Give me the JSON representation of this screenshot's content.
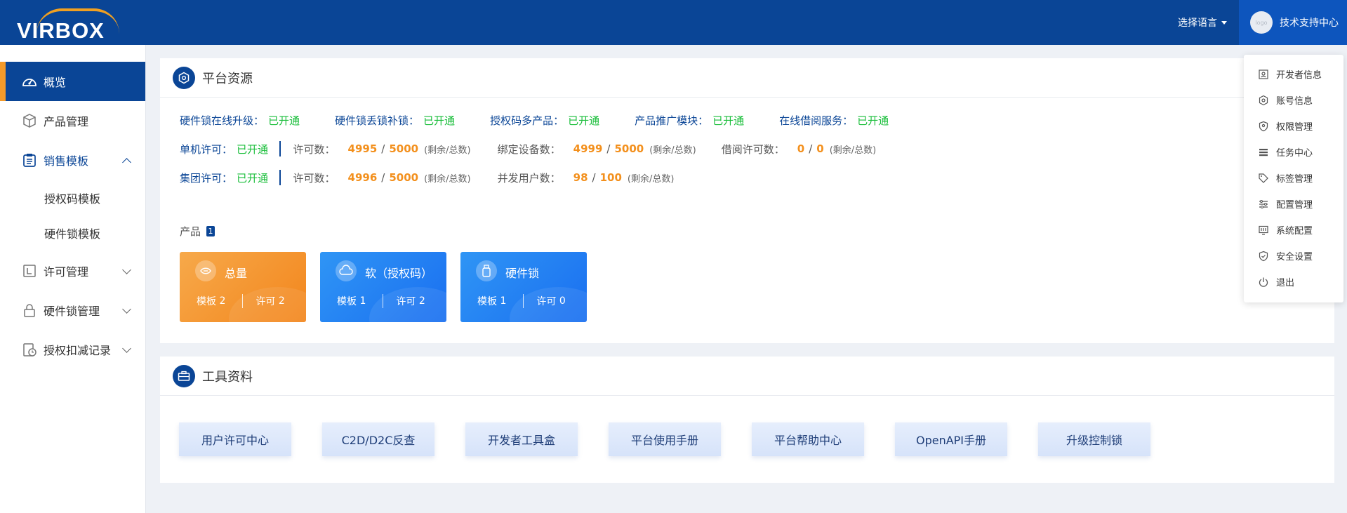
{
  "header": {
    "logo_text": "VIRBOX",
    "language_label": "选择语言",
    "avatar_text": "logo",
    "user_name": "技术支持中心"
  },
  "sidebar": {
    "items": [
      {
        "label": "概览",
        "icon": "dashboard-icon"
      },
      {
        "label": "产品管理",
        "icon": "cube-icon"
      },
      {
        "label": "销售模板",
        "icon": "clipboard-icon"
      },
      {
        "label": "许可管理",
        "icon": "license-icon"
      },
      {
        "label": "硬件锁管理",
        "icon": "lock-icon"
      },
      {
        "label": "授权扣减记录",
        "icon": "record-clock-icon"
      }
    ],
    "sub_items": [
      "授权码模板",
      "硬件锁模板"
    ]
  },
  "platform": {
    "title": "平台资源",
    "features": [
      {
        "label": "硬件锁在线升级：",
        "status": "已开通"
      },
      {
        "label": "硬件锁丢锁补锁：",
        "status": "已开通"
      },
      {
        "label": "授权码多产品：",
        "status": "已开通"
      },
      {
        "label": "产品推广模块：",
        "status": "已开通"
      },
      {
        "label": "在线借阅服务：",
        "status": "已开通"
      }
    ],
    "single_license": {
      "label": "单机许可：",
      "status": "已开通",
      "license_label": "许可数：",
      "license_remaining": "4995",
      "license_total": "5000",
      "note": "(剩余/总数)",
      "device_label": "绑定设备数：",
      "device_remaining": "4999",
      "device_total": "5000",
      "borrow_label": "借阅许可数：",
      "borrow_remaining": "0",
      "borrow_total": "0"
    },
    "group_license": {
      "label": "集团许可：",
      "status": "已开通",
      "license_label": "许可数：",
      "license_remaining": "4996",
      "license_total": "5000",
      "note": "(剩余/总数)",
      "users_label": "并发用户数：",
      "users_remaining": "98",
      "users_total": "100"
    },
    "products_label": "产品",
    "products_count": "1",
    "slash": "/",
    "tiles": [
      {
        "name": "总量",
        "template_label": "模板",
        "template_count": "2",
        "license_label": "许可",
        "license_count": "2"
      },
      {
        "name": "软（授权码）",
        "template_label": "模板",
        "template_count": "1",
        "license_label": "许可",
        "license_count": "2"
      },
      {
        "name": "硬件锁",
        "template_label": "模板",
        "template_count": "1",
        "license_label": "许可",
        "license_count": "0"
      }
    ]
  },
  "tools": {
    "title": "工具资料",
    "buttons": [
      "用户许可中心",
      "C2D/D2C反查",
      "开发者工具盒",
      "平台使用手册",
      "平台帮助中心",
      "OpenAPI手册",
      "升级控制锁"
    ]
  },
  "user_menu": {
    "items": [
      {
        "label": "开发者信息",
        "icon": "developer-icon"
      },
      {
        "label": "账号信息",
        "icon": "account-gear-icon"
      },
      {
        "label": "权限管理",
        "icon": "permission-shield-icon"
      },
      {
        "label": "任务中心",
        "icon": "task-list-icon"
      },
      {
        "label": "标签管理",
        "icon": "tag-icon"
      },
      {
        "label": "配置管理",
        "icon": "sliders-icon"
      },
      {
        "label": "系统配置",
        "icon": "system-monitor-icon"
      },
      {
        "label": "安全设置",
        "icon": "security-shield-icon"
      },
      {
        "label": "退出",
        "icon": "power-icon"
      }
    ]
  },
  "colors": {
    "primary": "#0a4596",
    "accent_orange": "#f39a2a",
    "status_green": "#19be3a",
    "number_orange": "#f3901d",
    "tile_blue": "#1a6ff0"
  }
}
